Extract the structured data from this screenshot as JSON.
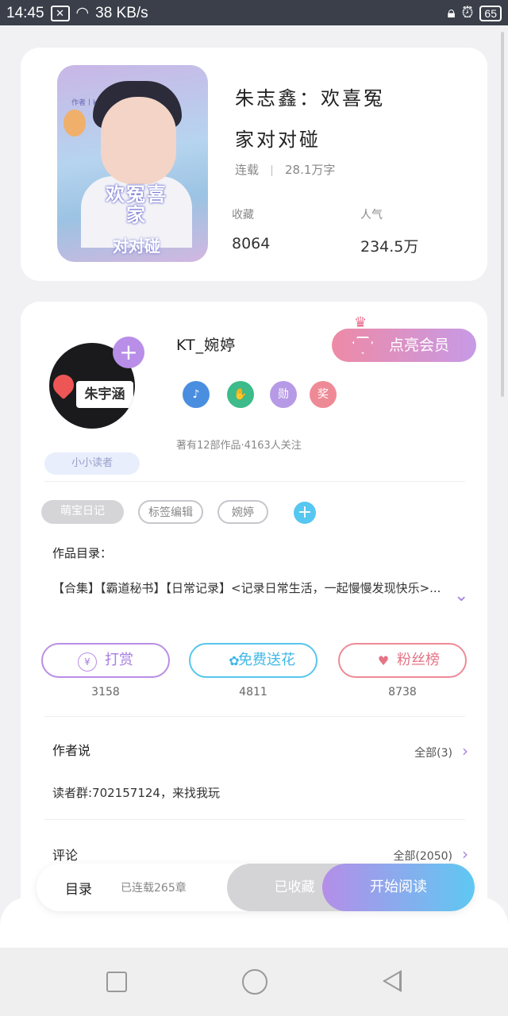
{
  "status_bar": {
    "time": "14:45",
    "network_speed": "38 KB/s",
    "battery": "65",
    "icons": [
      "image-icon",
      "wifi-icon",
      "lock-icon",
      "alarm-icon",
      "battery-icon"
    ]
  },
  "book": {
    "title_line1": "朱志鑫：欢喜冤",
    "title_line2": "家对对碰",
    "status": "连载",
    "word_count": "28.1万字",
    "collect_label": "收藏",
    "collect_value": "8064",
    "popularity_label": "人气",
    "popularity_value": "234.5万",
    "cover_tag": "作者丨kt_婉婷",
    "cover_title": "欢冤喜家",
    "cover_subtitle": "对对碰"
  },
  "author": {
    "name": "KT_婉婷",
    "vip_label": "点亮会员",
    "fan_tag": "小小读者",
    "stats": "著有12部作品·4163人关注",
    "medals": [
      "music-medal-icon",
      "handshake-medal-icon",
      "medal-badge-icon",
      "star-badge-icon"
    ],
    "medal_texts": [
      "",
      "",
      "勋",
      "奖"
    ],
    "tags": [
      "萌宝日记",
      "标签编辑",
      "婉婷"
    ],
    "works_label": "作品目录：",
    "works_list": "【合集】【霸道秘书】【日常记录】<记录日常生活，一起慢慢发现快乐>...",
    "actions": [
      {
        "label": "打赏",
        "count": "3158",
        "icon": "yen-icon"
      },
      {
        "label": "免费送花",
        "count": "4811",
        "icon": "flower-icon"
      },
      {
        "label": "粉丝榜",
        "count": "8738",
        "icon": "fans-icon"
      }
    ],
    "author_says_label": "作者说",
    "author_says_all": "全部(3)",
    "reader_group": "读者群:702157124，来找我玩",
    "comments_label": "评论",
    "comments_all": "全部(2050)"
  },
  "bottom_bar": {
    "catalog": "目录",
    "update": "已连载265章",
    "collected": "已收藏",
    "start_reading": "开始阅读"
  },
  "colors": {
    "accent_purple": "#b48ee8",
    "accent_blue": "#5fc8f2",
    "vip_pink": "#ee8aa6"
  }
}
